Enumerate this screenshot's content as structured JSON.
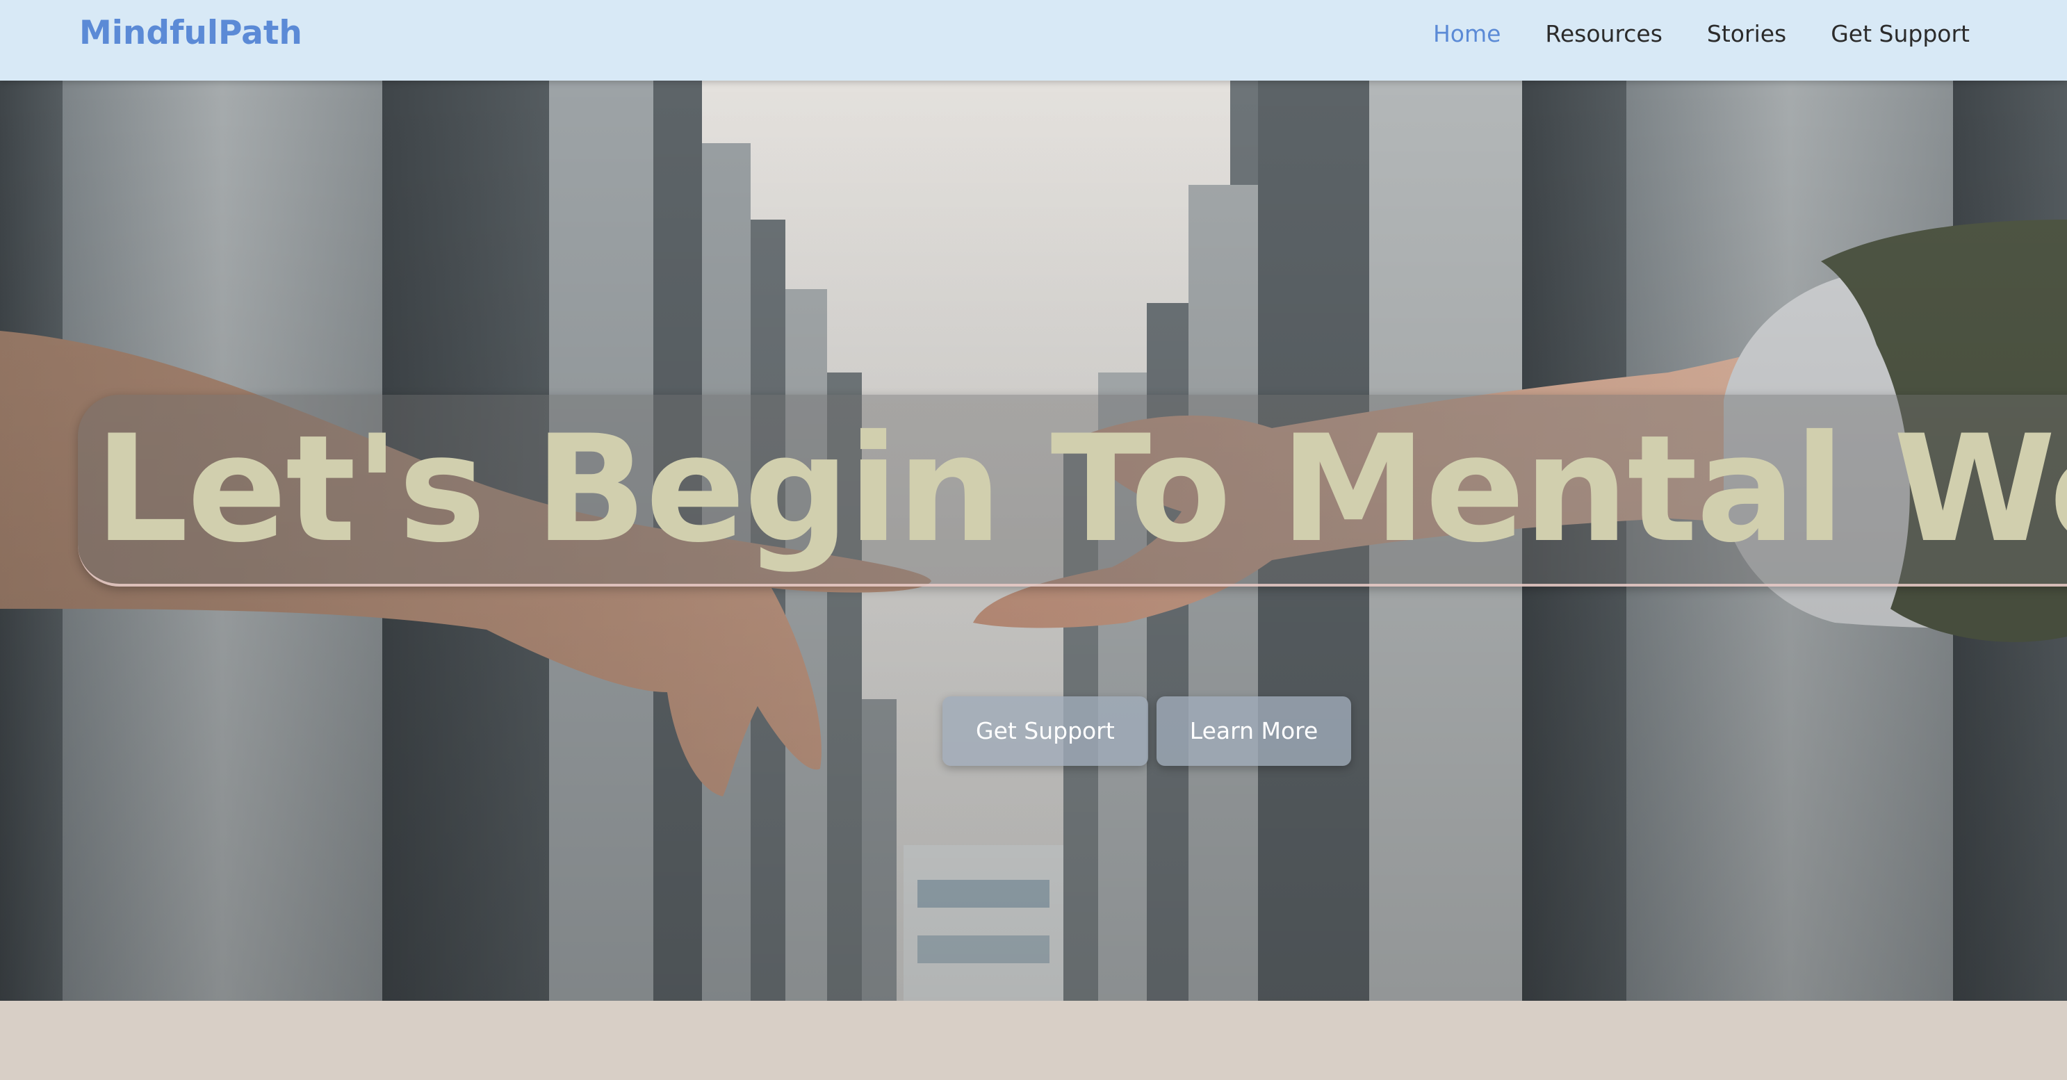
{
  "nav": {
    "brand": "MindfulPath",
    "links": [
      {
        "label": "Home",
        "active": true
      },
      {
        "label": "Resources",
        "active": false
      },
      {
        "label": "Stories",
        "active": false
      },
      {
        "label": "Get Support",
        "active": false
      }
    ]
  },
  "hero": {
    "headline": "Let's Begin To Mental Wellness",
    "buttons": [
      {
        "label": "Get Support"
      },
      {
        "label": "Learn More"
      }
    ]
  },
  "colors": {
    "navbar_bg": "#d8e9f6",
    "brand": "#5b8ad6",
    "active_link": "#5b8ad6",
    "headline": "#d1cfae",
    "page_bg": "#d8cfc6"
  }
}
